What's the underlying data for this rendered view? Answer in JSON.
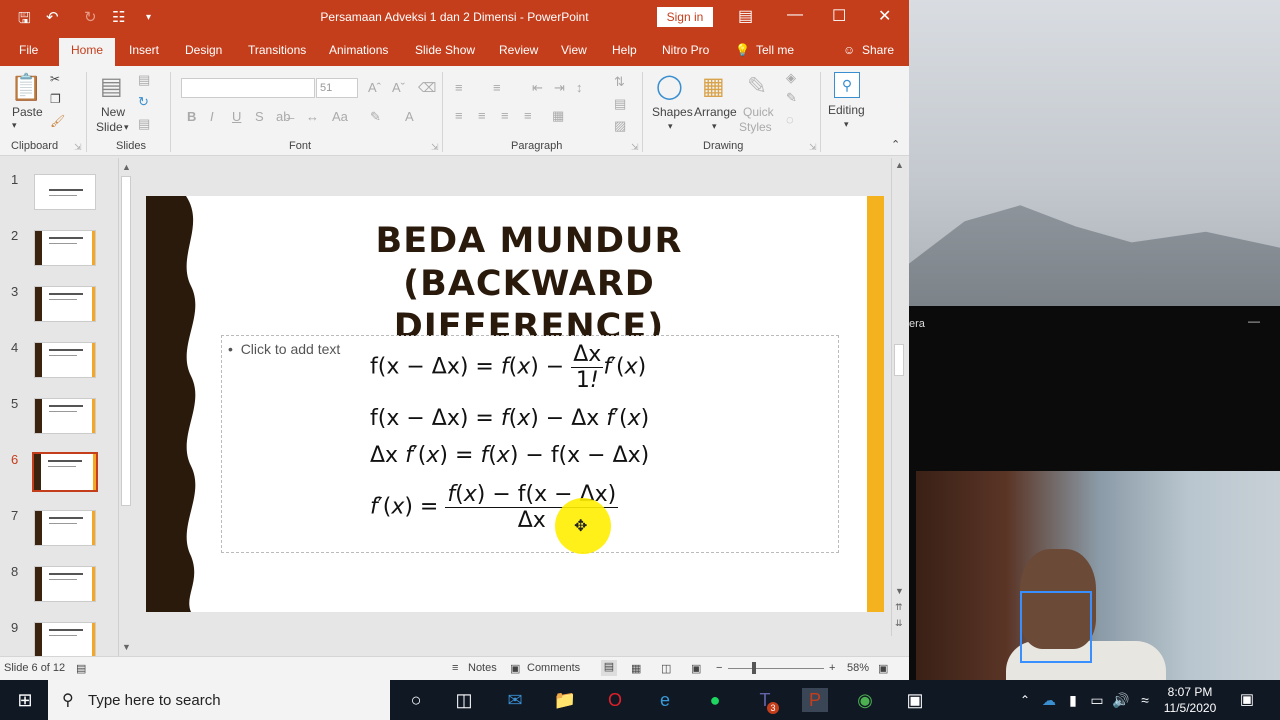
{
  "window": {
    "title": "Persamaan Adveksi 1 dan 2 Dimensi  -  PowerPoint",
    "sign_in": "Sign in"
  },
  "tabs": [
    "File",
    "Home",
    "Insert",
    "Design",
    "Transitions",
    "Animations",
    "Slide Show",
    "Review",
    "View",
    "Help",
    "Nitro Pro",
    "Tell me",
    "Share"
  ],
  "ribbon": {
    "paste": "Paste",
    "new_slide": "New",
    "new_slide2": "Slide",
    "font_size": "51",
    "shapes": "Shapes",
    "arrange": "Arrange",
    "quick_styles": "Quick",
    "quick_styles2": "Styles",
    "editing": "Editing",
    "groups": {
      "clipboard": "Clipboard",
      "slides": "Slides",
      "font": "Font",
      "paragraph": "Paragraph",
      "drawing": "Drawing"
    }
  },
  "thumbnails": {
    "numbers": [
      "1",
      "2",
      "3",
      "4",
      "5",
      "6",
      "7",
      "8",
      "9"
    ],
    "selected": 6
  },
  "slide": {
    "title_line1": "BEDA MUNDUR (BACKWARD",
    "title_line2": "DIFFERENCE)",
    "placeholder": "Click to add text",
    "accent_color": "#f5b21f",
    "wave_color": "#2a1a0c"
  },
  "status": {
    "slide_indicator": "Slide 6 of 12",
    "notes": "Notes",
    "comments": "Comments",
    "zoom": "58%"
  },
  "camera": {
    "title_fragment": "era"
  },
  "taskbar": {
    "search_placeholder": "Type here to search",
    "time": "8:07 PM",
    "date": "11/5/2020",
    "teams_badge": "3"
  }
}
